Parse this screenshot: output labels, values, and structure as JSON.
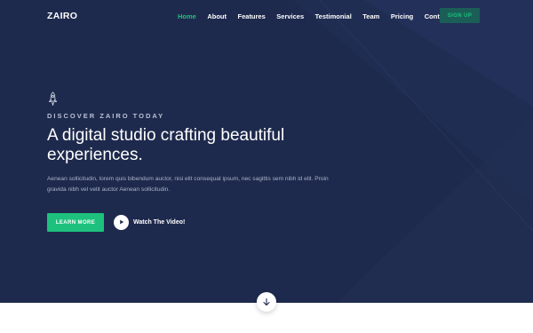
{
  "brand": {
    "name": "ZAIRO"
  },
  "nav": {
    "items": [
      {
        "label": "Home",
        "active": true
      },
      {
        "label": "About",
        "active": false
      },
      {
        "label": "Features",
        "active": false
      },
      {
        "label": "Services",
        "active": false
      },
      {
        "label": "Testimonial",
        "active": false
      },
      {
        "label": "Team",
        "active": false
      },
      {
        "label": "Pricing",
        "active": false
      },
      {
        "label": "Contact",
        "active": false
      }
    ],
    "signup_label": "SIGN UP"
  },
  "hero": {
    "icon": "rocket-icon",
    "eyebrow": "DISCOVER ZAIRO TODAY",
    "headline": "A digital studio crafting beautiful experiences.",
    "description": "Aenean sollicitudin, lorem quis bibendum auctor, nisi elit consequat ipsum, nec sagittis sem nibh id elit. Proin gravida nibh vel velit auctor Aenean sollicitudin.",
    "cta_label": "LEARN MORE",
    "video_label": "Watch The Video!",
    "scroll_icon": "arrow-down-icon"
  },
  "colors": {
    "hero_background": "#1e2a4d",
    "accent_green": "#1dc17d",
    "signup_background": "#1b5e57",
    "text_white": "#ffffff",
    "text_muted": "#aab2c8"
  }
}
